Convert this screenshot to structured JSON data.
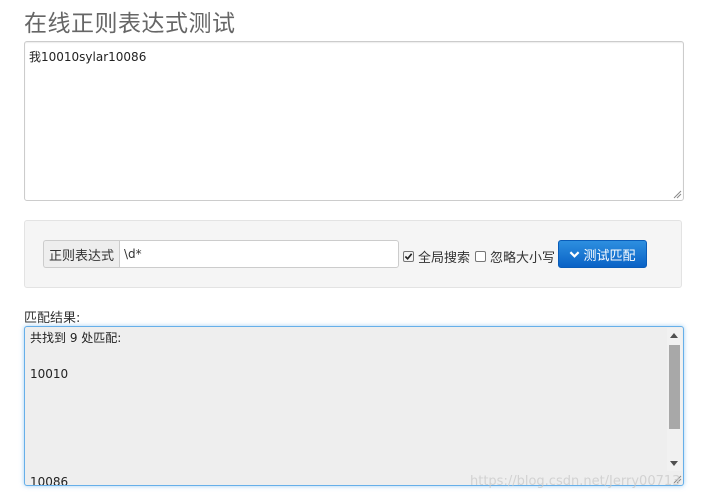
{
  "page": {
    "title": "在线正则表达式测试"
  },
  "source": {
    "text": "我10010sylar10086"
  },
  "controls": {
    "regex_label": "正则表达式",
    "regex_value": "\\d*",
    "global_label": "全局搜索",
    "global_checked": true,
    "ignore_case_label": "忽略大小写",
    "ignore_case_checked": false,
    "test_button_label": "测试匹配",
    "test_button_icon": "chevron-down-icon",
    "accent_color": "#0a62c6"
  },
  "results": {
    "label": "匹配结果:",
    "lines": [
      "共找到 9 处匹配:",
      "",
      "10010",
      "",
      "",
      "",
      "",
      "",
      "10086"
    ]
  },
  "watermark": {
    "text": "https://blog.csdn.net/Jerry00713"
  }
}
